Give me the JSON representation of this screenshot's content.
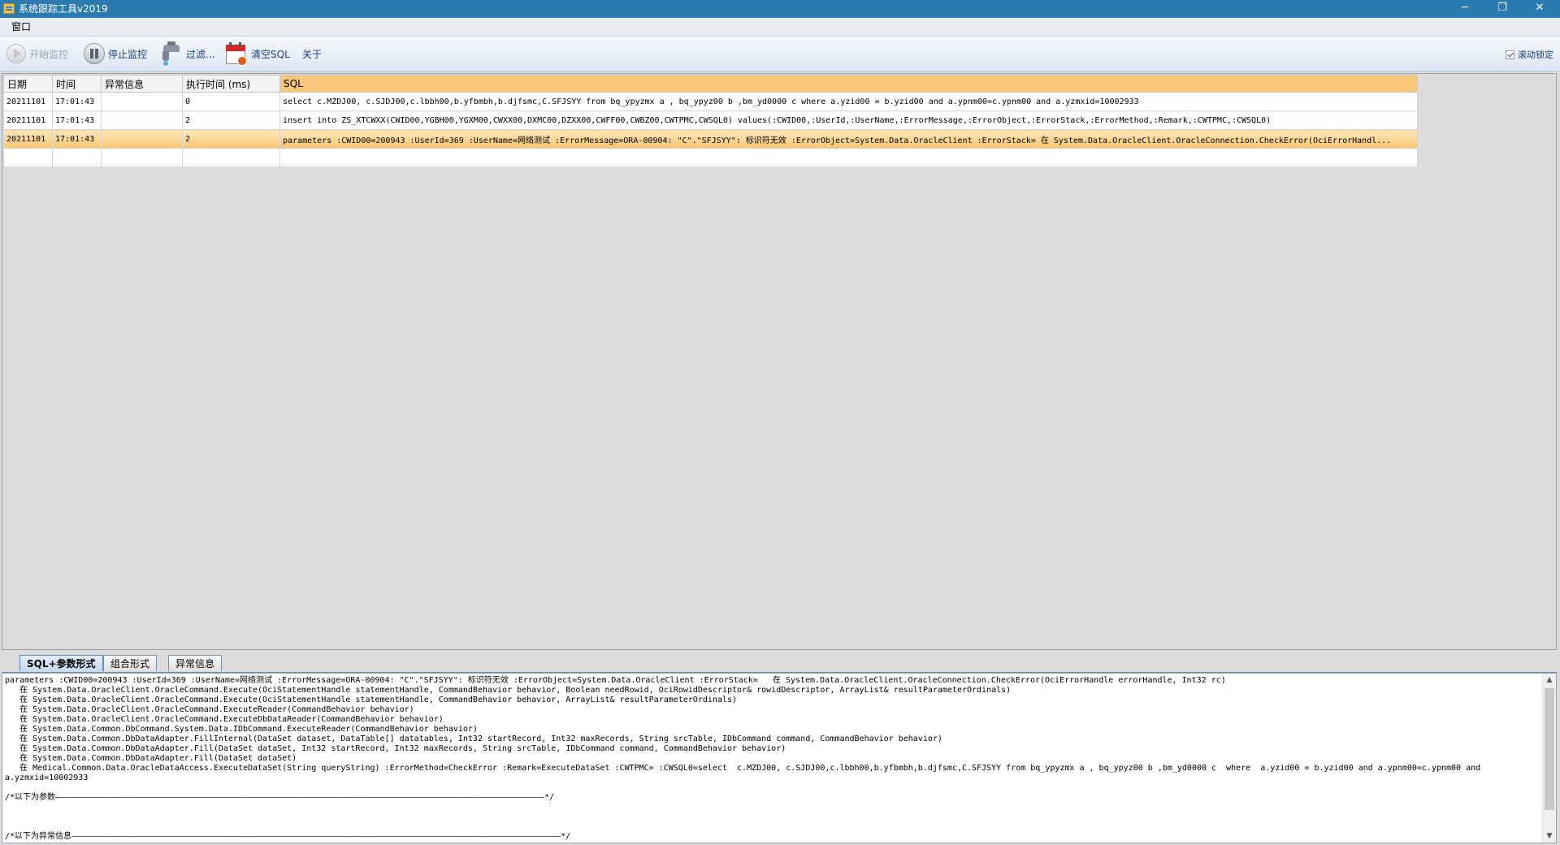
{
  "window": {
    "title": "系统跟踪工具v2019",
    "minimize": "─",
    "maximize": "❐",
    "close": "✕"
  },
  "menu": {
    "items": [
      "窗口"
    ]
  },
  "toolbar": {
    "start_label": "开始监控",
    "stop_label": "停止监控",
    "filter_label": "过滤...",
    "clear_label": "清空SQL",
    "about_label": "关于",
    "scroll_lock_label": "滚动锁定",
    "scroll_lock_checked": true
  },
  "grid": {
    "columns": [
      "日期",
      "时间",
      "异常信息",
      "执行时间 (ms)",
      "SQL"
    ],
    "rows": [
      [
        "20211101",
        "17:01:43",
        "",
        "0",
        "select  c.MZDJ00, c.SJDJ00,c.lbbh00,b.yfbmbh,b.djfsmc,C.SFJSYY from bq_ypyzmx a , bq_ypyz00 b ,bm_yd0000 c  where  a.yzid00 = b.yzid00 and a.ypnm00=c.ypnm00 and a.yzmxid=10002933"
      ],
      [
        "20211101",
        "17:01:43",
        "",
        "2",
        "insert into ZS_XTCWXX(CWID00,YGBH00,YGXM00,CWXX00,DXMC00,DZXX00,CWFF00,CWBZ00,CWTPMC,CWSQL0) values(:CWID00,:UserId,:UserName,:ErrorMessage,:ErrorObject,:ErrorStack,:ErrorMethod,:Remark,:CWTPMC,:CWSQL0)"
      ],
      [
        "20211101",
        "17:01:43",
        "",
        "2",
        "parameters :CWID00=200943 :UserId=369 :UserName=网络测试 :ErrorMessage=ORA-00904: \"C\".\"SFJSYY\": 标识符无效 :ErrorObject=System.Data.OracleClient :ErrorStack=   在 System.Data.OracleClient.OracleConnection.CheckError(OciErrorHandl..."
      ],
      [
        "",
        "",
        "",
        "",
        ""
      ]
    ],
    "selected_row": 2
  },
  "tabs": [
    {
      "label": "SQL+参数形式",
      "active": true
    },
    {
      "label": "组合形式",
      "active": false
    },
    {
      "label": "异常信息",
      "active": false
    }
  ],
  "detail_text": "parameters :CWID00=200943 :UserId=369 :UserName=网络测试 :ErrorMessage=ORA-00904: \"C\".\"SFJSYY\": 标识符无效 :ErrorObject=System.Data.OracleClient :ErrorStack=   在 System.Data.OracleClient.OracleConnection.CheckError(OciErrorHandle errorHandle, Int32 rc)\n   在 System.Data.OracleClient.OracleCommand.Execute(OciStatementHandle statementHandle, CommandBehavior behavior, Boolean needRowid, OciRowidDescriptor& rowidDescriptor, ArrayList& resultParameterOrdinals)\n   在 System.Data.OracleClient.OracleCommand.Execute(OciStatementHandle statementHandle, CommandBehavior behavior, ArrayList& resultParameterOrdinals)\n   在 System.Data.OracleClient.OracleCommand.ExecuteReader(CommandBehavior behavior)\n   在 System.Data.OracleClient.OracleCommand.ExecuteDbDataReader(CommandBehavior behavior)\n   在 System.Data.Common.DbCommand.System.Data.IDbCommand.ExecuteReader(CommandBehavior behavior)\n   在 System.Data.Common.DbDataAdapter.FillInternal(DataSet dataset, DataTable[] datatables, Int32 startRecord, Int32 maxRecords, String srcTable, IDbCommand command, CommandBehavior behavior)\n   在 System.Data.Common.DbDataAdapter.Fill(DataSet dataSet, Int32 startRecord, Int32 maxRecords, String srcTable, IDbCommand command, CommandBehavior behavior)\n   在 System.Data.Common.DbDataAdapter.Fill(DataSet dataSet)\n   在 Medical.Common.Data.OracleDataAccess.ExecuteDataSet(String queryString) :ErrorMethod=CheckError :Remark=ExecuteDataSet :CWTPMC= :CWSQL0=select  c.MZDJ00, c.SJDJ00,c.lbbh00,b.yfbmbh,b.djfsmc,C.SFJSYY from bq_ypyzmx a , bq_ypyz00 b ,bm_yd0000 c  where  a.yzid00 = b.yzid00 and a.ypnm00=c.ypnm00 and\na.yzmxid=10002933\n\n/*以下为参数————————————————————————————————————————————————————————————————————————————————————————————————————*/\n\n\n\n/*以下为异常信息————————————————————————————————————————————————————————————————————————————————————————————————————*/"
}
